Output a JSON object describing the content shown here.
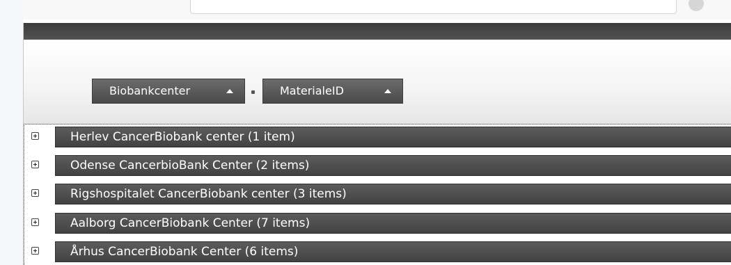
{
  "group_panel": {
    "chips": [
      {
        "label": "Biobankcenter",
        "sort": "ascending"
      },
      {
        "label": "MaterialeID",
        "sort": "ascending"
      }
    ]
  },
  "groups": [
    {
      "label": "Herlev CancerBiobank center (1 item)"
    },
    {
      "label": "Odense CancerbioBank Center (2 items)"
    },
    {
      "label": "Rigshospitalet CancerBiobank center (3 items)"
    },
    {
      "label": "Aalborg CancerBiobank Center (7 items)"
    },
    {
      "label": "Århus CancerBiobank Center (6 items)"
    }
  ],
  "icons": {
    "expand": "plus-box-icon",
    "sort": "sort-ascending-icon",
    "search": "search-icon"
  },
  "colors": {
    "header_dark": "#4a4a4a",
    "panel_light": "#f4f4f4",
    "text_light": "#ffffff"
  }
}
